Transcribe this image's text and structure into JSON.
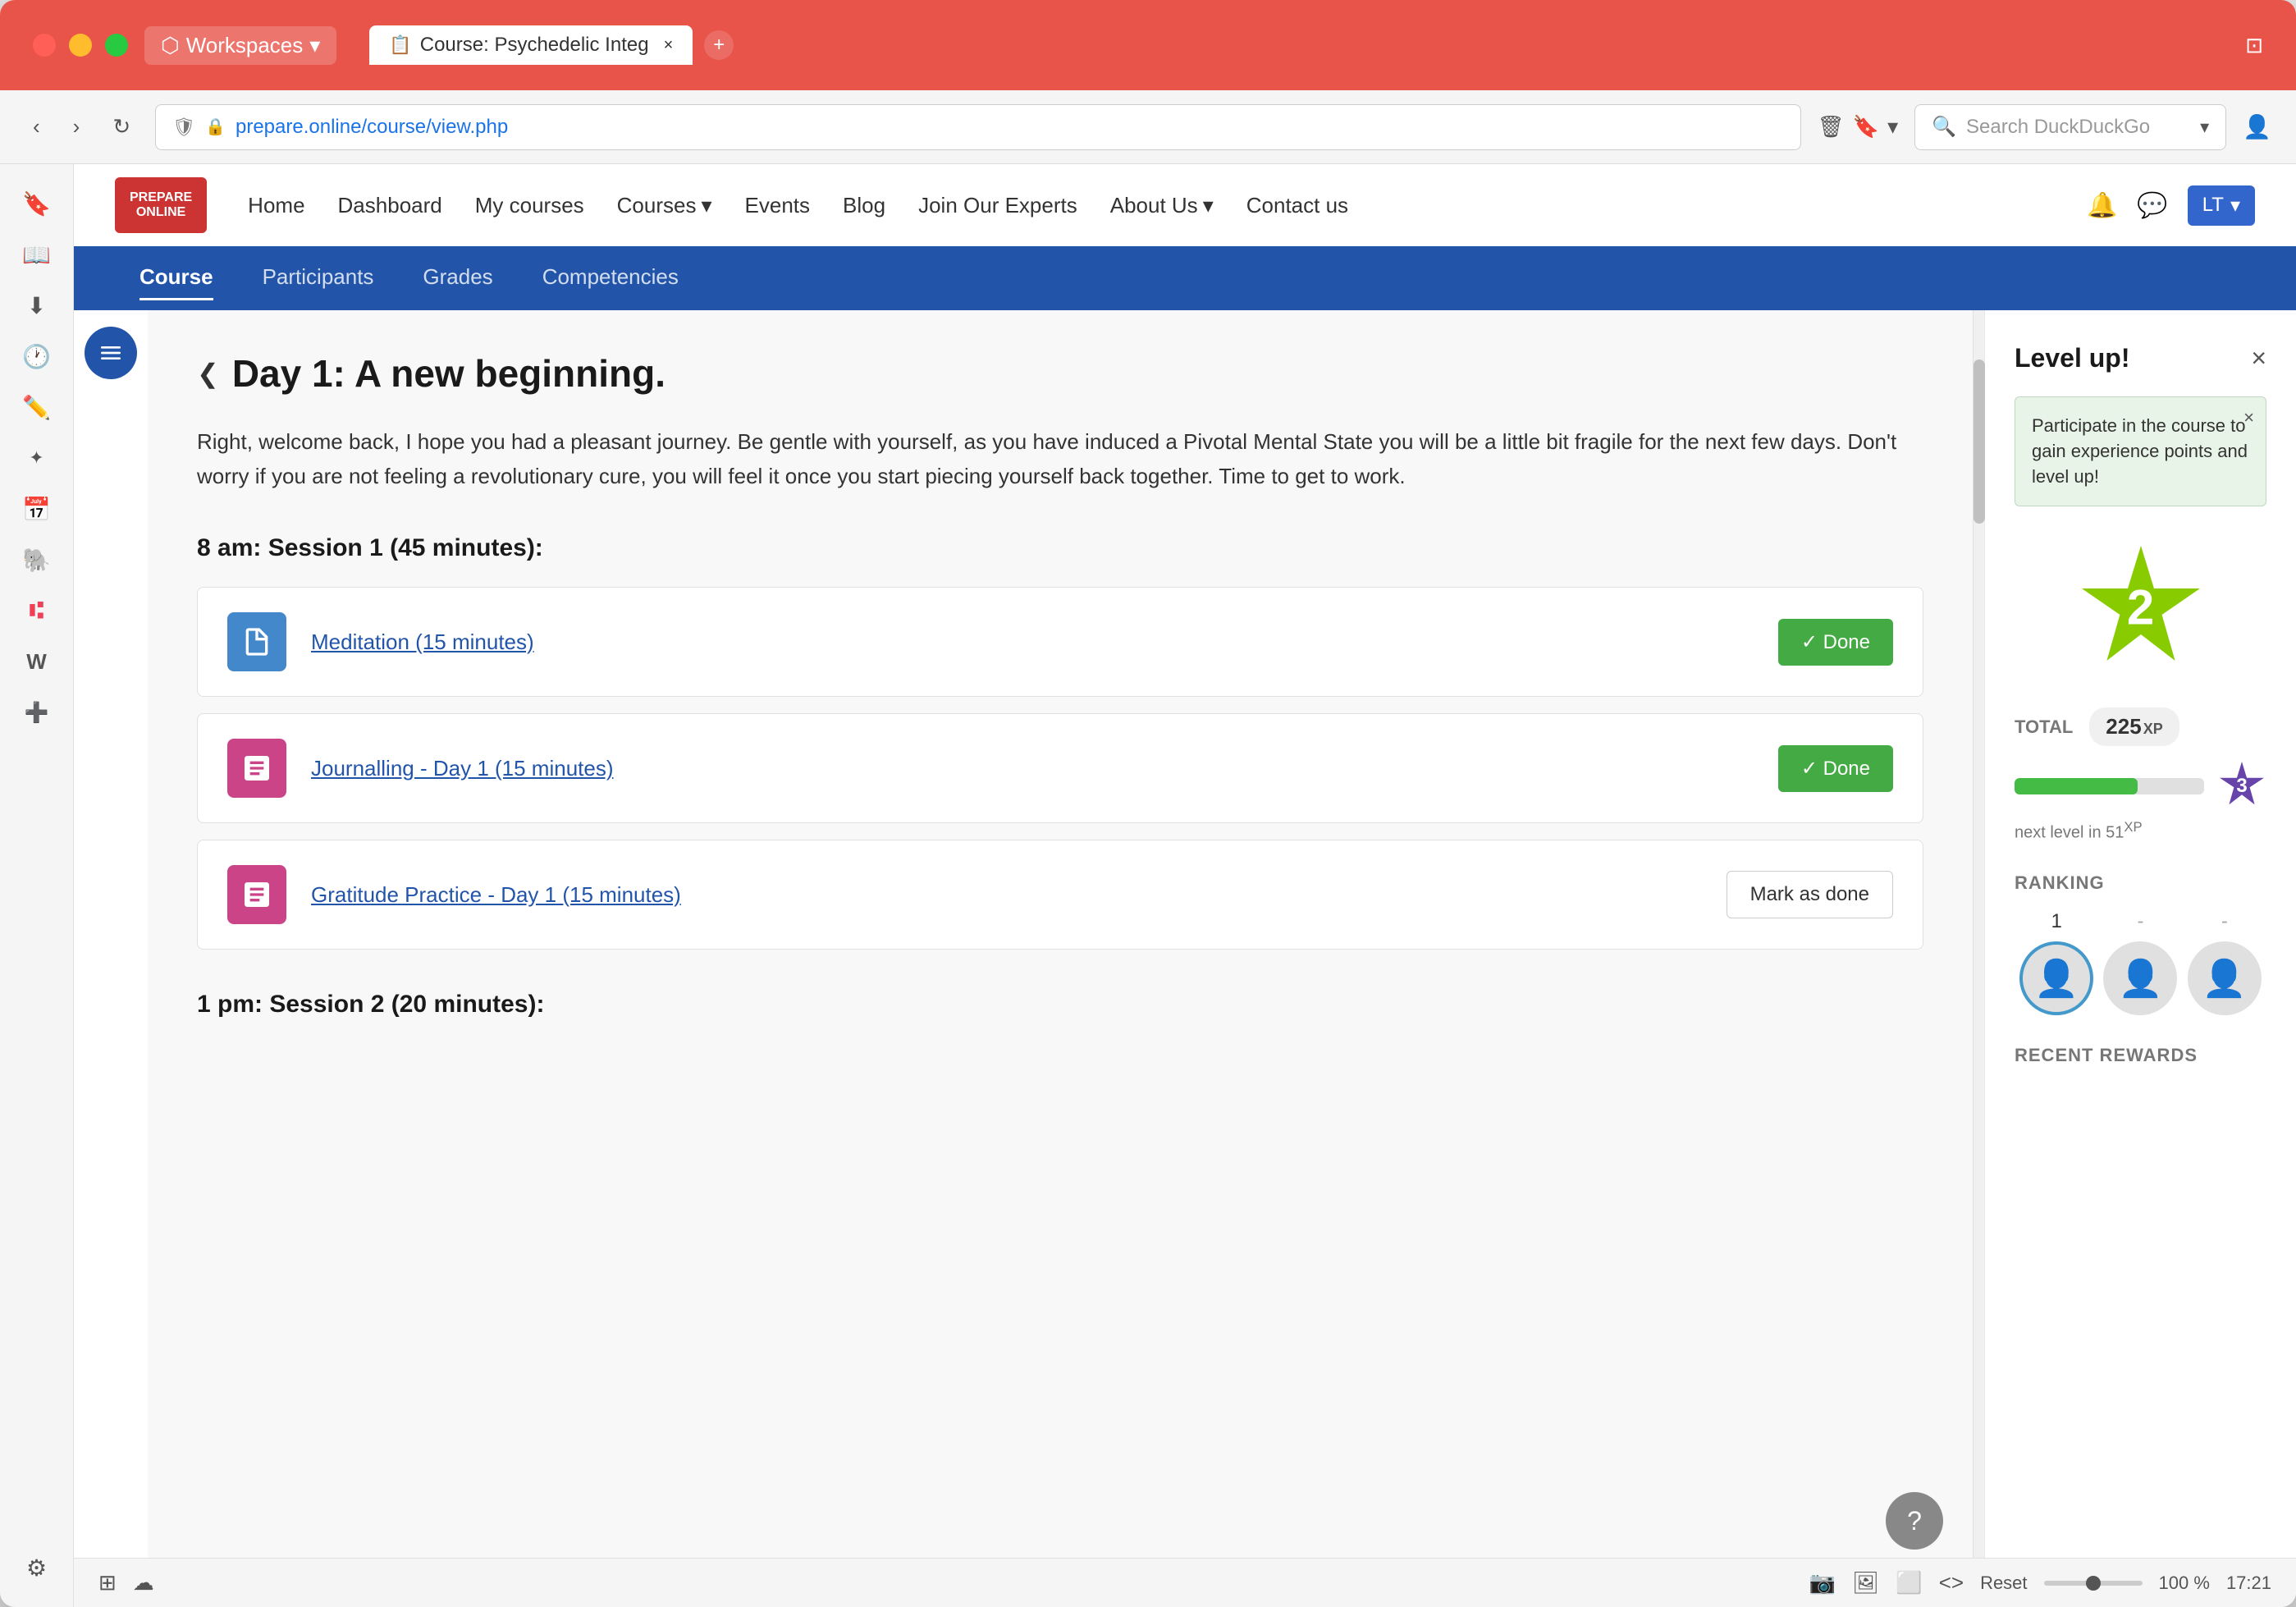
{
  "browser": {
    "traffic_lights": [
      "red",
      "yellow",
      "green"
    ],
    "workspace_label": "Workspaces",
    "tab_title": "Course: Psychedelic Integ",
    "new_tab_label": "+",
    "address": "prepare.online/course/view.php",
    "address_domain": "prepare.online",
    "address_path": "/course/view.php",
    "search_placeholder": "Search DuckDuckGo",
    "user_initials": "LT"
  },
  "sidebar_icons": [
    {
      "name": "bookmark-icon",
      "icon": "🔖",
      "label": "Bookmarks"
    },
    {
      "name": "reader-icon",
      "icon": "📖",
      "label": "Reader"
    },
    {
      "name": "download-icon",
      "icon": "⬇",
      "label": "Downloads"
    },
    {
      "name": "history-icon",
      "icon": "🕐",
      "label": "History"
    },
    {
      "name": "edit-icon",
      "icon": "✏️",
      "label": "Edit"
    },
    {
      "name": "spark-icon",
      "icon": "✦",
      "label": "Spark"
    },
    {
      "name": "calendar-icon",
      "icon": "📅",
      "label": "Calendar"
    },
    {
      "name": "mastodon-icon",
      "icon": "🐘",
      "label": "Mastodon"
    },
    {
      "name": "pocket-icon",
      "icon": "🅿",
      "label": "Pocket"
    },
    {
      "name": "wikipedia-icon",
      "icon": "W",
      "label": "Wikipedia"
    },
    {
      "name": "add-icon",
      "icon": "➕",
      "label": "Add"
    },
    {
      "name": "settings-icon",
      "icon": "⚙",
      "label": "Settings"
    }
  ],
  "site_header": {
    "logo_line1": "PREPARE",
    "logo_line2": "ONLINE",
    "nav_items": [
      {
        "label": "Home",
        "has_dropdown": false
      },
      {
        "label": "Dashboard",
        "has_dropdown": false
      },
      {
        "label": "My courses",
        "has_dropdown": false
      },
      {
        "label": "Courses",
        "has_dropdown": true
      },
      {
        "label": "Events",
        "has_dropdown": false
      },
      {
        "label": "Blog",
        "has_dropdown": false
      },
      {
        "label": "Join Our Experts",
        "has_dropdown": false
      },
      {
        "label": "About Us",
        "has_dropdown": true
      },
      {
        "label": "Contact us",
        "has_dropdown": false
      }
    ],
    "user_label": "LT"
  },
  "course_nav": {
    "tabs": [
      {
        "label": "Course",
        "active": true
      },
      {
        "label": "Participants",
        "active": false
      },
      {
        "label": "Grades",
        "active": false
      },
      {
        "label": "Competencies",
        "active": false
      }
    ]
  },
  "course": {
    "day_title": "Day 1: A new beginning.",
    "day_description": "Right, welcome back, I hope you had a pleasant journey. Be gentle with yourself, as you have induced a Pivotal Mental State you will be a little bit fragile for the next few days. Don't worry if you are not feeling a revolutionary cure, you will feel it once you start piecing yourself back together. Time to get to work.",
    "session1_header": "8 am: Session 1 (45 minutes):",
    "session2_header": "1 pm: Session 2 (20 minutes):",
    "activities": [
      {
        "id": "meditation",
        "icon_color": "blue",
        "title": "Meditation (15 minutes)",
        "status": "done",
        "done_label": "✓ Done"
      },
      {
        "id": "journalling",
        "icon_color": "pink",
        "title": "Journalling - Day 1 (15 minutes)",
        "status": "done",
        "done_label": "✓ Done"
      },
      {
        "id": "gratitude",
        "icon_color": "pink",
        "title": "Gratitude Practice - Day 1 (15 minutes)",
        "status": "pending",
        "mark_done_label": "Mark as done"
      }
    ]
  },
  "level_panel": {
    "title": "Level up!",
    "close_icon": "×",
    "tooltip_text": "Participate in the course to gain experience points and level up!",
    "current_level": "2",
    "total_label": "TOTAL",
    "xp_amount": "225",
    "xp_unit": "XP",
    "next_level": "3",
    "next_level_text": "next level in 51",
    "next_level_xp": "XP",
    "progress_percent": 65,
    "ranking_label": "RANKING",
    "rank_1": "1",
    "rank_2": "-",
    "rank_3": "-",
    "recent_rewards_label": "RECENT REWARDS"
  },
  "status_bar": {
    "zoom_label": "Reset",
    "zoom_value": "100 %",
    "time": "17:21"
  }
}
